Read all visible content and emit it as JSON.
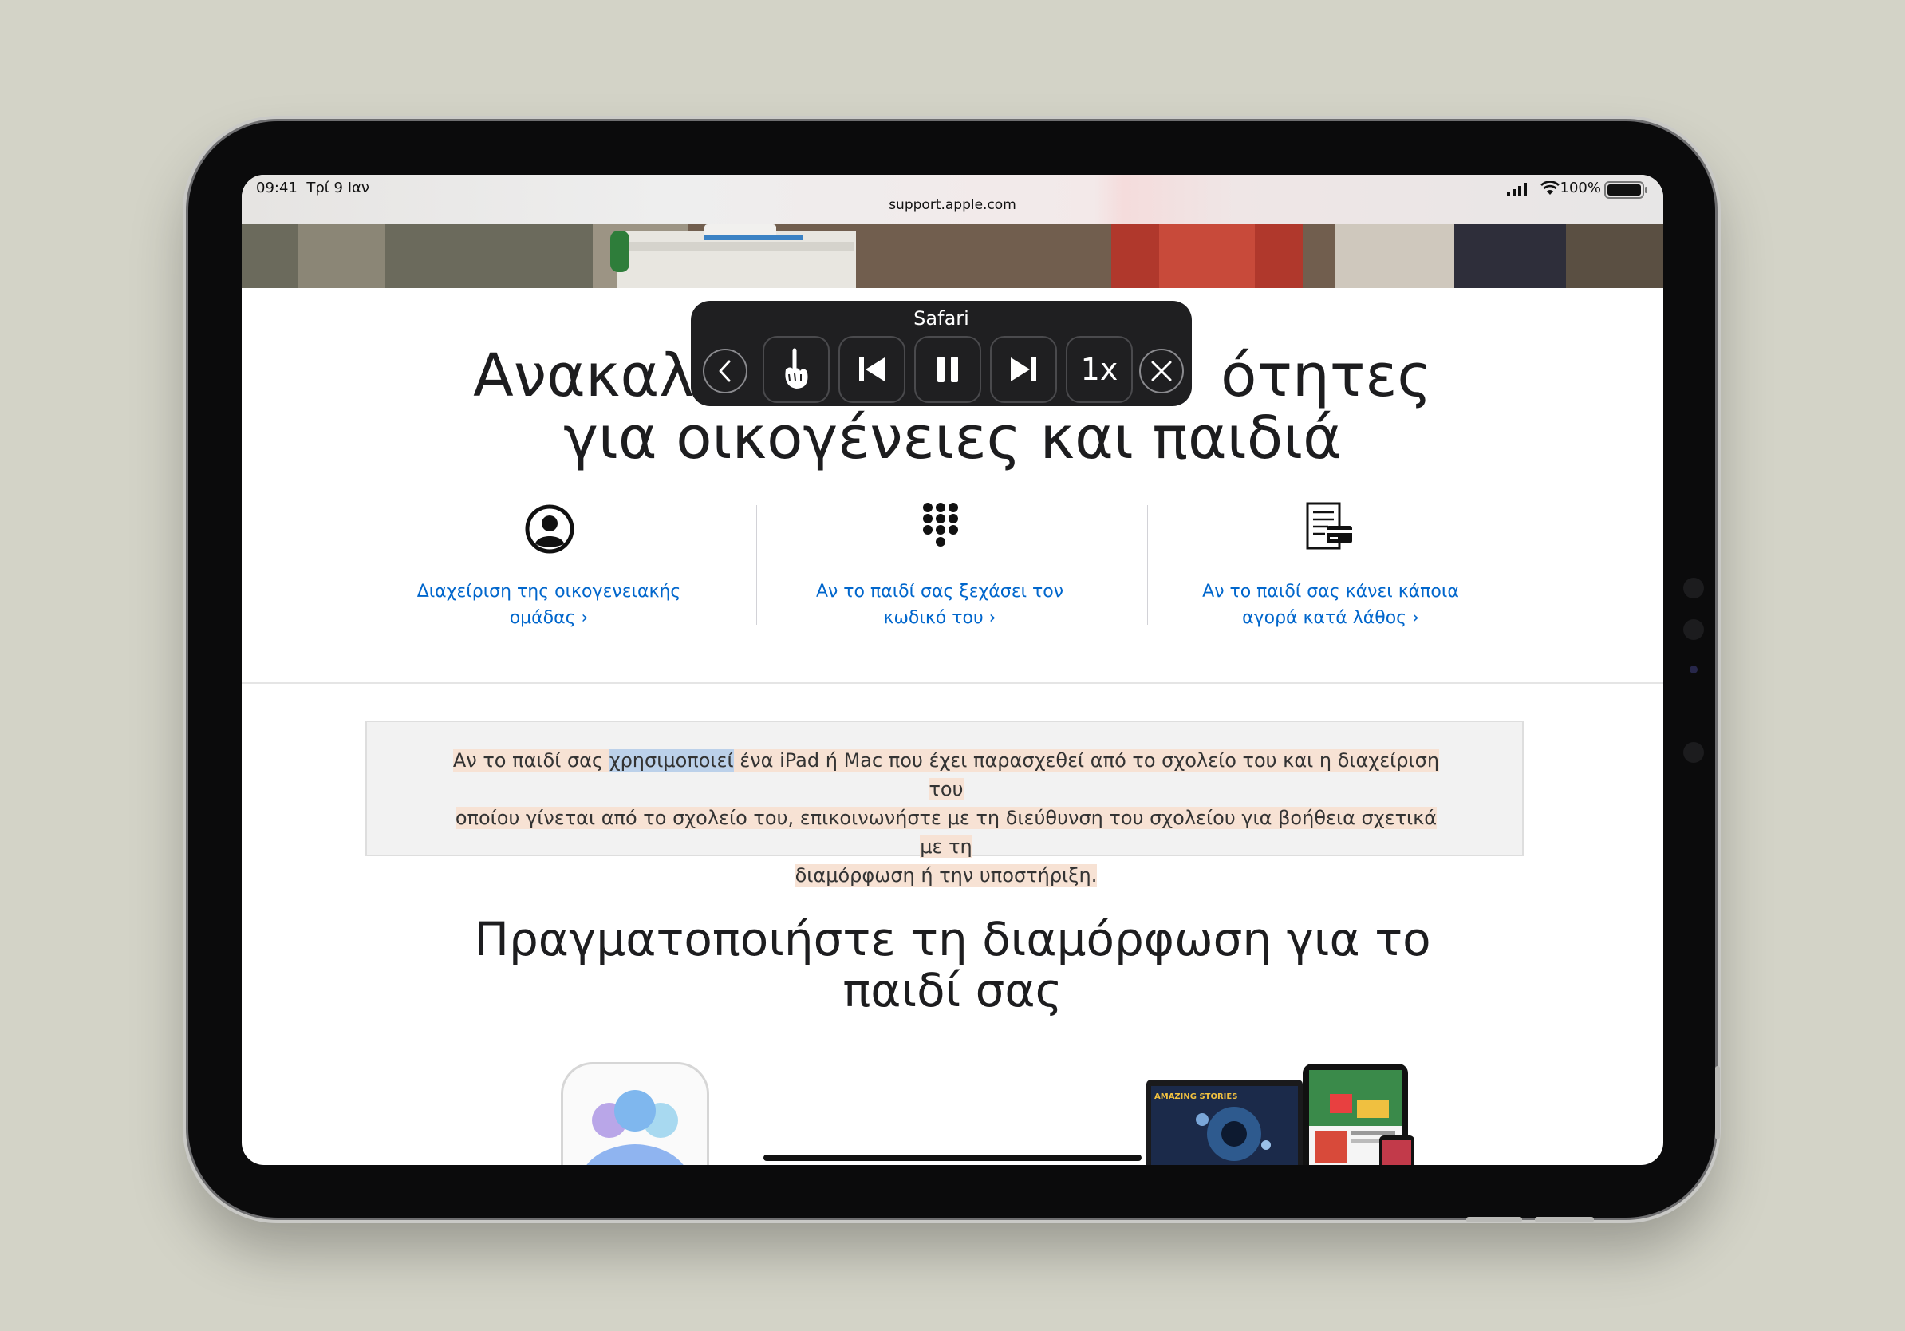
{
  "status_bar": {
    "time": "09:41",
    "date": "Τρί 9 Ιαν",
    "battery": "100%"
  },
  "browser": {
    "url": "support.apple.com"
  },
  "page": {
    "heading_line1_left": "Ανακαλ",
    "heading_line1_right": "ότητες",
    "heading_line2": "για οικογένειες και παιδιά",
    "cards": [
      {
        "icon": "person-circle-icon",
        "line1": "Διαχείριση της οικογενειακής",
        "line2": "ομάδας ›"
      },
      {
        "icon": "keypad-icon",
        "line1": "Αν το παιδί σας ξεχάσει τον",
        "line2": "κωδικό του ›"
      },
      {
        "icon": "receipt-card-icon",
        "line1": "Αν το παιδί σας κάνει κάποια",
        "line2": "αγορά κατά λάθος ›"
      }
    ],
    "note": {
      "before": "Αν το παιδί σας ",
      "highlighted_word": "χρησιμοποιεί",
      "after_line1": " ένα iPad ή Mac που έχει παρασχεθεί από το σχολείο του και η διαχείριση του",
      "line2": "οποίου γίνεται από το σχολείο του, επικοινωνήστε με τη διεύθυνση του σχολείου για βοήθεια σχετικά με τη",
      "line3": "διαμόρφωση ή την υποστήριξη."
    },
    "section_heading_line1": "Πραγματοποιήστε τη διαμόρφωση για το",
    "section_heading_line2": "παιδί σας",
    "image_label": "AMAZING STORIES"
  },
  "speak_controller": {
    "title": "Safari",
    "speed": "1x",
    "state": "playing"
  },
  "colors": {
    "link": "#0066cc",
    "sentence_highlight": "#f7e2d4",
    "word_highlight": "#bcd1ea",
    "controller_bg": "#1f1f21"
  }
}
